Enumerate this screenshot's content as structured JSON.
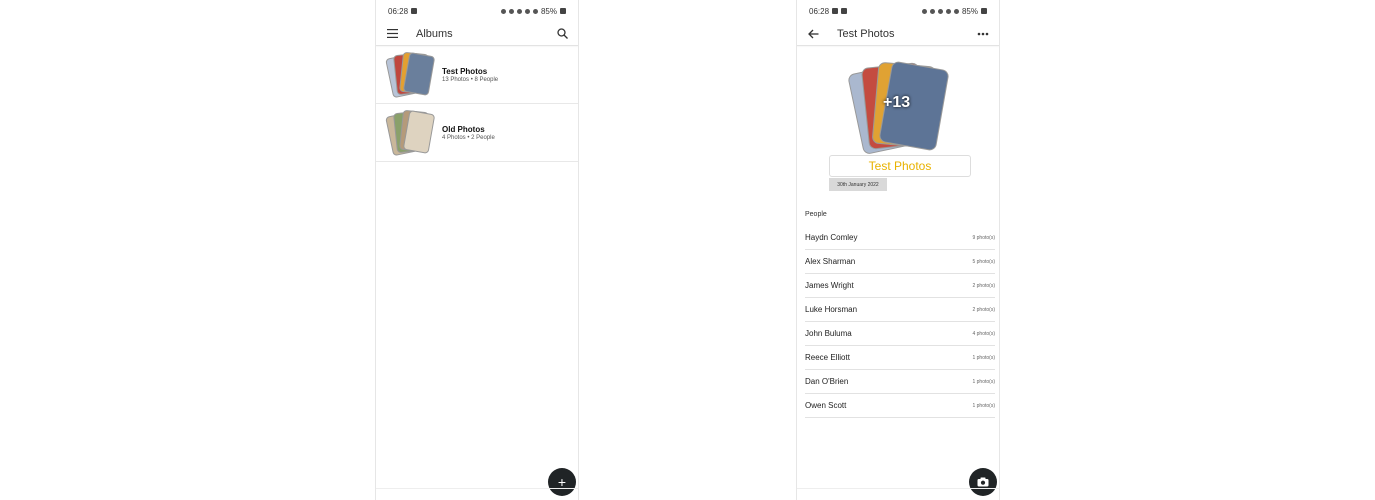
{
  "left": {
    "status": {
      "time": "06:28",
      "battery": "85%"
    },
    "appbar": {
      "title": "Albums"
    },
    "albums": [
      {
        "name": "Test Photos",
        "meta": "13 Photos • 8 People"
      },
      {
        "name": "Old Photos",
        "meta": "4 Photos • 2 People"
      }
    ],
    "fab": {
      "glyph": "+"
    }
  },
  "right": {
    "status": {
      "time": "06:28",
      "battery": "85%"
    },
    "appbar": {
      "title": "Test Photos"
    },
    "cover": {
      "count": "+13"
    },
    "album_title": "Test Photos",
    "album_date": "30th January 2022",
    "people_label": "People",
    "people": [
      {
        "name": "Haydn Comley",
        "count": "9 photo(s)"
      },
      {
        "name": "Alex Sharman",
        "count": "5 photo(s)"
      },
      {
        "name": "James Wright",
        "count": "2 photo(s)"
      },
      {
        "name": "Luke Horsman",
        "count": "2 photo(s)"
      },
      {
        "name": "John Buluma",
        "count": "4 photo(s)"
      },
      {
        "name": "Reece Elliott",
        "count": "1 photo(s)"
      },
      {
        "name": "Dan O'Brien",
        "count": "1 photo(s)"
      },
      {
        "name": "Owen Scott",
        "count": "1 photo(s)"
      }
    ]
  },
  "colors": {
    "accent": "#e8b200",
    "fab": "#202426"
  }
}
